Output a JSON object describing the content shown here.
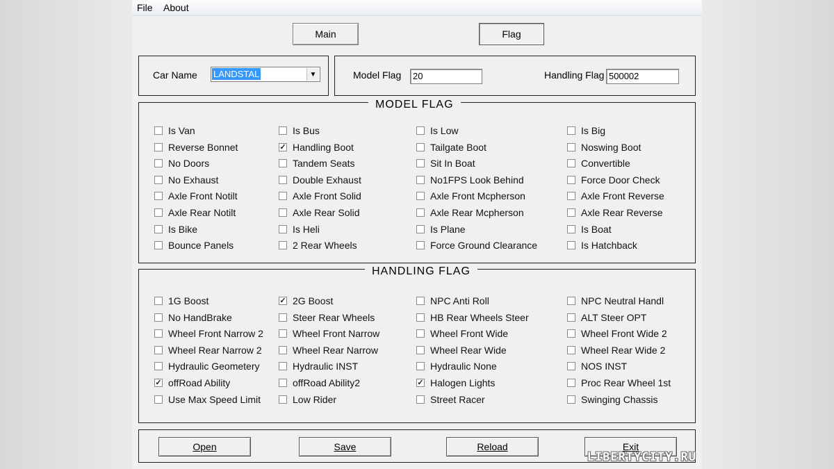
{
  "menu": {
    "file": "File",
    "about": "About"
  },
  "tabs": {
    "main": "Main",
    "flag": "Flag"
  },
  "car": {
    "label": "Car Name",
    "value": "LANDSTAL",
    "arrow": "▼"
  },
  "flags": {
    "model_label": "Model Flag",
    "model_value": "20",
    "handling_label": "Handling Flag",
    "handling_value": "500002"
  },
  "model_flag": {
    "title": "MODEL  FLAG",
    "columns": [
      [
        {
          "label": "Is Van",
          "checked": false
        },
        {
          "label": "Reverse Bonnet",
          "checked": false
        },
        {
          "label": "No Doors",
          "checked": false
        },
        {
          "label": "No Exhaust",
          "checked": false
        },
        {
          "label": "Axle Front Notilt",
          "checked": false
        },
        {
          "label": "Axle Rear Notilt",
          "checked": false
        },
        {
          "label": "Is Bike",
          "checked": false
        },
        {
          "label": "Bounce Panels",
          "checked": false
        }
      ],
      [
        {
          "label": "Is Bus",
          "checked": false
        },
        {
          "label": "Handling Boot",
          "checked": true
        },
        {
          "label": "Tandem Seats",
          "checked": false
        },
        {
          "label": "Double Exhaust",
          "checked": false
        },
        {
          "label": "Axle Front Solid",
          "checked": false
        },
        {
          "label": "Axle Rear Solid",
          "checked": false
        },
        {
          "label": "Is Heli",
          "checked": false
        },
        {
          "label": "2 Rear Wheels",
          "checked": false
        }
      ],
      [
        {
          "label": "Is Low",
          "checked": false
        },
        {
          "label": "Tailgate Boot",
          "checked": false
        },
        {
          "label": "Sit In Boat",
          "checked": false
        },
        {
          "label": "No1FPS Look Behind",
          "checked": false
        },
        {
          "label": "Axle Front Mcpherson",
          "checked": false
        },
        {
          "label": "Axle Rear Mcpherson",
          "checked": false
        },
        {
          "label": "Is Plane",
          "checked": false
        },
        {
          "label": "Force Ground Clearance",
          "checked": false
        }
      ],
      [
        {
          "label": "Is Big",
          "checked": false
        },
        {
          "label": "Noswing Boot",
          "checked": false
        },
        {
          "label": "Convertible",
          "checked": false
        },
        {
          "label": "Force Door Check",
          "checked": false
        },
        {
          "label": "Axle Front Reverse",
          "checked": false
        },
        {
          "label": "Axle Rear Reverse",
          "checked": false
        },
        {
          "label": "Is Boat",
          "checked": false
        },
        {
          "label": "Is Hatchback",
          "checked": false
        }
      ]
    ]
  },
  "handling_flag": {
    "title": "HANDLING  FLAG",
    "columns": [
      [
        {
          "label": "1G Boost",
          "checked": false
        },
        {
          "label": "No HandBrake",
          "checked": false
        },
        {
          "label": "Wheel Front Narrow 2",
          "checked": false
        },
        {
          "label": "Wheel Rear Narrow 2",
          "checked": false
        },
        {
          "label": "Hydraulic Geometery",
          "checked": false
        },
        {
          "label": "offRoad Ability",
          "checked": true
        },
        {
          "label": "Use Max Speed Limit",
          "checked": false
        }
      ],
      [
        {
          "label": "2G Boost",
          "checked": true
        },
        {
          "label": "Steer Rear Wheels",
          "checked": false
        },
        {
          "label": "Wheel Front Narrow",
          "checked": false
        },
        {
          "label": "Wheel Rear Narrow",
          "checked": false
        },
        {
          "label": "Hydraulic INST",
          "checked": false
        },
        {
          "label": "offRoad Ability2",
          "checked": false
        },
        {
          "label": "Low Rider",
          "checked": false
        }
      ],
      [
        {
          "label": "NPC Anti Roll",
          "checked": false
        },
        {
          "label": "HB Rear Wheels Steer",
          "checked": false
        },
        {
          "label": "Wheel Front Wide",
          "checked": false
        },
        {
          "label": "Wheel Rear Wide",
          "checked": false
        },
        {
          "label": "Hydraulic None",
          "checked": false
        },
        {
          "label": "Halogen Lights",
          "checked": true
        },
        {
          "label": "Street Racer",
          "checked": false
        }
      ],
      [
        {
          "label": "NPC Neutral Handl",
          "checked": false
        },
        {
          "label": "ALT Steer OPT",
          "checked": false
        },
        {
          "label": "Wheel Front Wide 2",
          "checked": false
        },
        {
          "label": "Wheel Rear Wide 2",
          "checked": false
        },
        {
          "label": "NOS INST",
          "checked": false
        },
        {
          "label": "Proc Rear Wheel 1st",
          "checked": false
        },
        {
          "label": "Swinging Chassis",
          "checked": false
        }
      ]
    ]
  },
  "buttons": {
    "open": "Open",
    "save": "Save",
    "reload": "Reload",
    "exit": "Exit"
  },
  "watermark": "LIBERTYCITY.RU"
}
